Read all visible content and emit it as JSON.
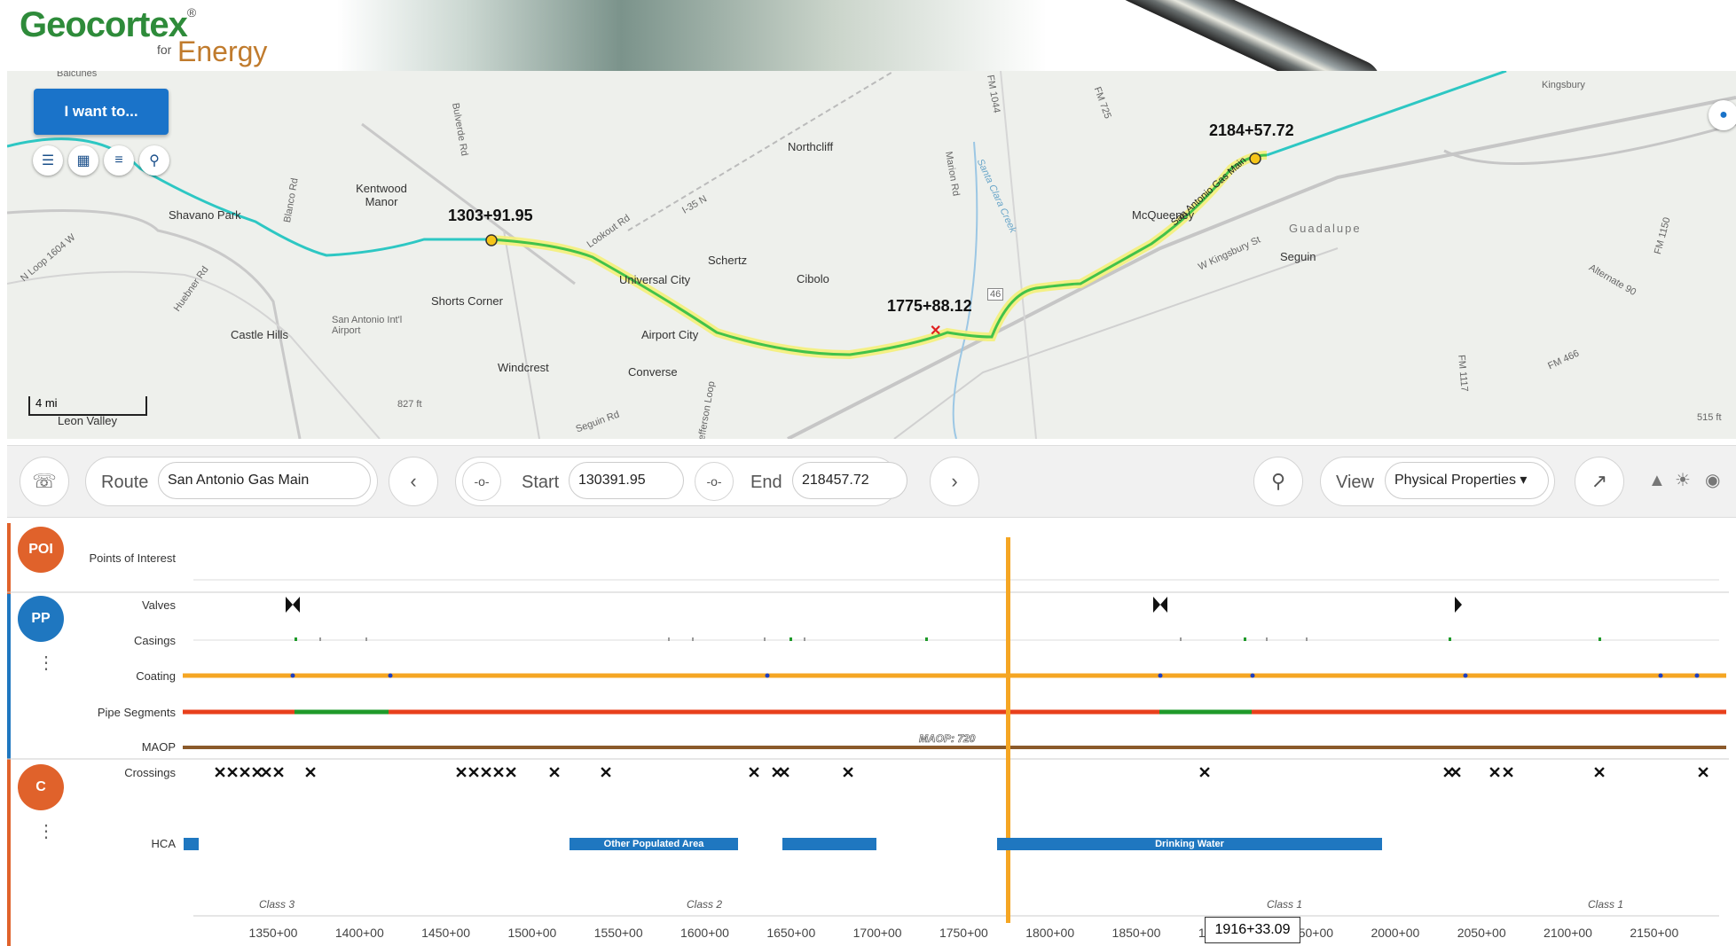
{
  "header": {
    "logo_main": "Geocortex",
    "logo_reg": "®",
    "logo_for": "for",
    "logo_sub": "Energy"
  },
  "map": {
    "i_want_button": "I want to...",
    "scale_label": "4 mi",
    "labels": [
      "Balcunes",
      "Kentwood Manor",
      "Shavano Park",
      "Northcliff",
      "Schertz",
      "Cibolo",
      "Universal City",
      "Shorts Corner",
      "Castle Hills",
      "San Antonio Int'l Airport",
      "Airport City",
      "Windcrest",
      "Converse",
      "Leon Valley",
      "McQueeney",
      "Guadalupe",
      "Seguin",
      "Kingsbury",
      "N Loop 1604 W",
      "Huebner Rd",
      "Blanco Rd",
      "Bulverde Rd",
      "Lookout Rd",
      "FM 1044",
      "FM 725",
      "Marion Rd",
      "Santa Clara Creek",
      "W Kingsbury St",
      "Alternate 90",
      "FM 466",
      "FM 1117",
      "FM 1150",
      "Jefferson Loop",
      "Seguin Rd",
      "827 ft",
      "515 ft",
      "I-35 N",
      "San Antonio Gas Main"
    ],
    "stations": {
      "a": "1303+91.95",
      "b": "1775+88.12",
      "c": "2184+57.72"
    },
    "shield": "46"
  },
  "toolbar": {
    "route_label": "Route",
    "route_value": "San Antonio Gas Main",
    "start_label": "Start",
    "start_value": "130391.95",
    "end_label": "End",
    "end_value": "218457.72",
    "view_label": "View",
    "view_value": "Physical Properties"
  },
  "groups": {
    "poi": "POI",
    "pp": "PP",
    "c": "C"
  },
  "rows": {
    "poi": "Points of Interest",
    "valves": "Valves",
    "casings": "Casings",
    "coating": "Coating",
    "pipe_segments": "Pipe Segments",
    "maop": "MAOP",
    "crossings": "Crossings",
    "hca": "HCA"
  },
  "maop_label": "MAOP: 720",
  "hca_labels": {
    "opa": "Other Populated Area",
    "dw": "Drinking Water"
  },
  "class_labels": [
    "Class 3",
    "Class 2",
    "Class 1",
    "Class 1"
  ],
  "axis_ticks": [
    "1350+00",
    "1400+00",
    "1450+00",
    "1500+00",
    "1550+00",
    "1600+00",
    "1650+00",
    "1700+00",
    "1750+00",
    "1800+00",
    "1850+00",
    "1900+00",
    "1950+00",
    "2000+00",
    "2050+00",
    "2100+00",
    "2150+00"
  ],
  "cursor_readout": "1916+33.09",
  "colors": {
    "accent": "#1a73c9",
    "poi": "#e0622b",
    "pp": "#1f77c0",
    "c": "#e0622b",
    "coating": "#f5a623",
    "pipe_red": "#e8401c",
    "pipe_green": "#1f9a2a",
    "maop": "#8b5a2b",
    "cursor": "#f5a623"
  }
}
